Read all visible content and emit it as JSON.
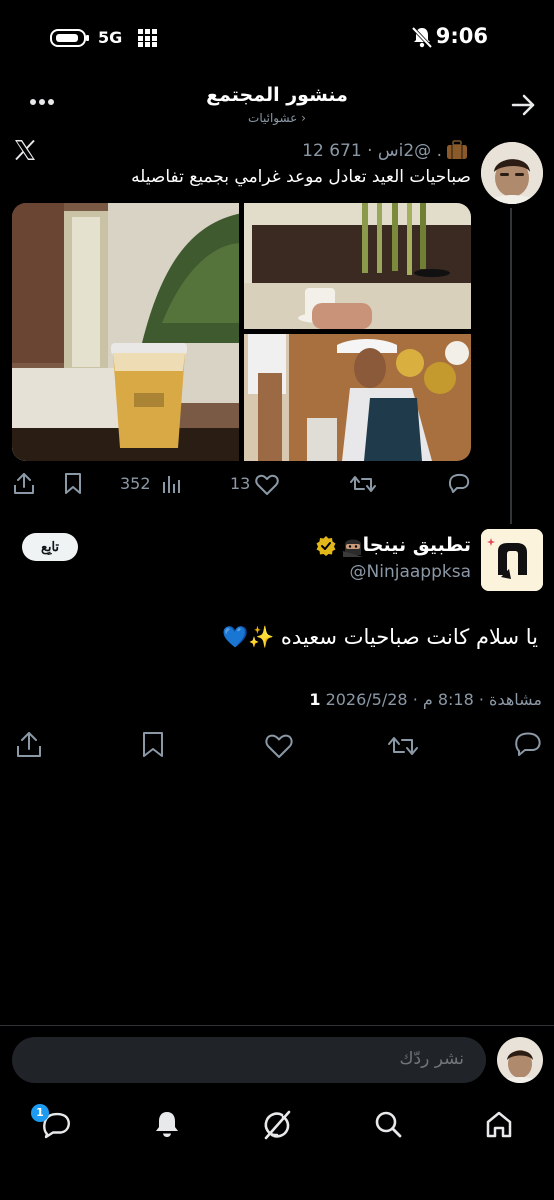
{
  "status_bar": {
    "time": "9:06",
    "network": "5G"
  },
  "header": {
    "title": "منشور المجتمع",
    "subtitle": "عشوائيات ›"
  },
  "parent_post": {
    "meta": "12 س · 671i2@ .",
    "text": "صباحيات العيد تعادل موعد غرامي بجميع تفاصيله",
    "views": "352",
    "likes": "13"
  },
  "main_post": {
    "author_name": "تطبيق نينجا",
    "handle": "@Ninjaappksa",
    "follow_label": "تابِع",
    "text": "يا سلام كانت صباحيات سعيده ✨💙",
    "views_count": "1",
    "meta_rest": "مشاهدة · 8:18 م · 2026/5/28"
  },
  "reply": {
    "placeholder": "نشر ردّك"
  },
  "bottom_nav": {
    "messages_badge": "1"
  }
}
